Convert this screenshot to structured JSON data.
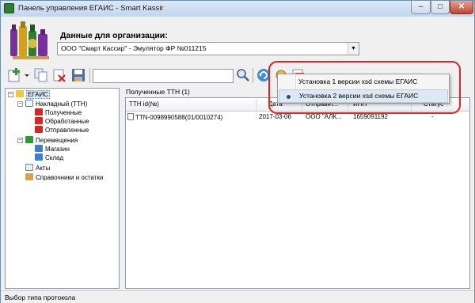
{
  "window": {
    "title": "Панель управления ЕГАИС - Smart Kassir",
    "minimize": "–",
    "maximize": "□",
    "close": "✕"
  },
  "header": {
    "org_label": "Данные для организации:",
    "org_selected": "ООО \"Смарт Кассир\" - Эмулятор ФР №011215"
  },
  "toolbar": {
    "icons": [
      "add-icon",
      "dropdown-arrow-icon",
      "copy-icon",
      "delete-icon",
      "save-icon",
      "search-icon",
      "refresh-icon",
      "settings-icon",
      "export-icon"
    ],
    "search_value": ""
  },
  "tree": {
    "root": "ЕГАИС",
    "nodes": [
      "Накладный (ТТН)",
      "Полученные",
      "Обработанные",
      "Отправленные",
      "Перемещения",
      "Магазин",
      "Склад",
      "Акты",
      "Справочники и остатки"
    ]
  },
  "main": {
    "caption": "Полученные ТТН (1)",
    "columns": [
      "ТТН id(№)",
      "Дата",
      "Отправит...",
      "ИНН",
      "Статус"
    ],
    "rows": [
      {
        "id": "TTN-0098990588(01/0010274)",
        "date": "2017-03-06",
        "sender": "ООО \"АЛК...",
        "inn": "1659091192",
        "status": "-"
      }
    ]
  },
  "context_menu": {
    "items": [
      {
        "label": "Установка 1 версии xsd схемы ЕГАИС",
        "checked": false
      },
      {
        "label": "Установка 2 версии xsd схемы ЕГАИС",
        "checked": true
      }
    ]
  },
  "statusbar": {
    "text": "Выбор типа протокола"
  },
  "colors": {
    "highlight_ring": "#e02424",
    "menu_highlight": "#dde8f5",
    "titlebar": "#c2d6ee"
  }
}
